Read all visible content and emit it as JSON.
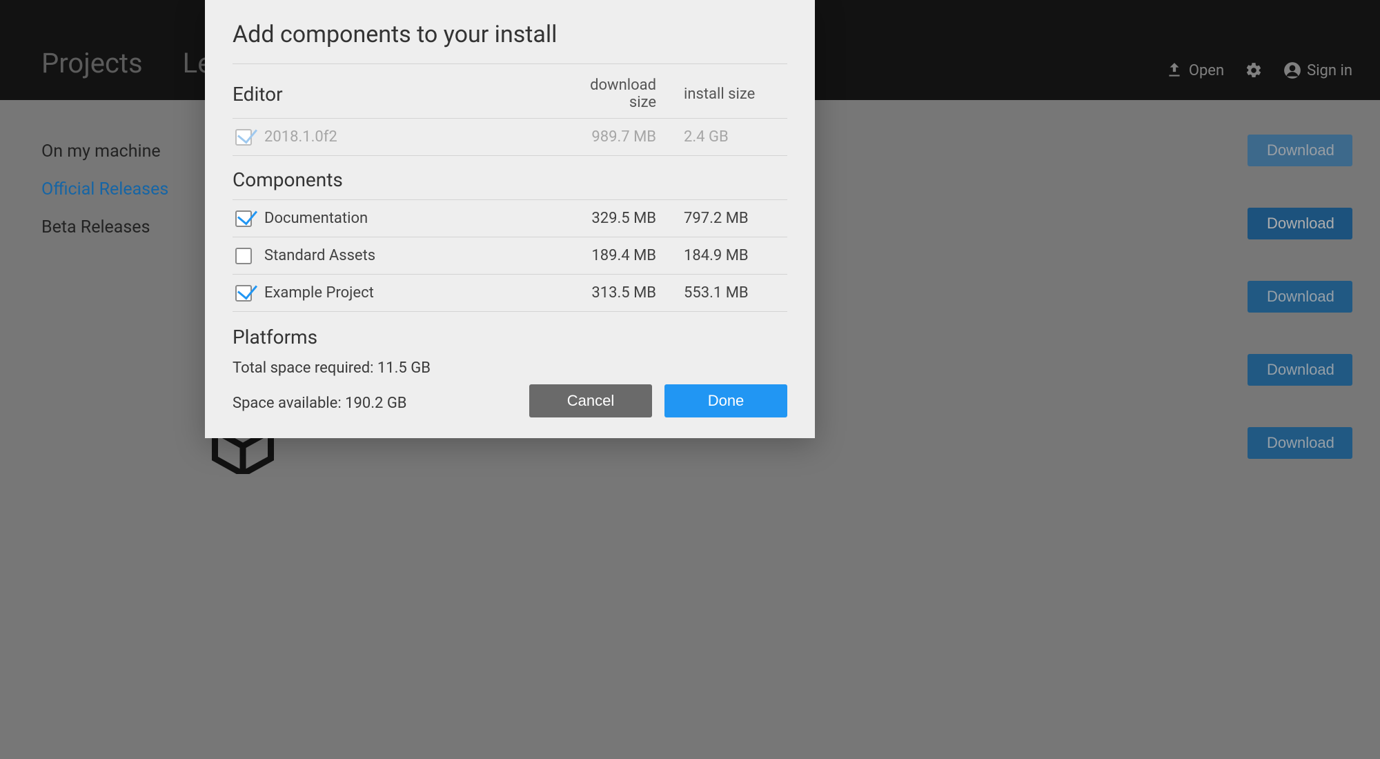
{
  "topbar": {
    "tabs": [
      "Projects",
      "Learn"
    ],
    "open_label": "Open",
    "signin_label": "Sign in"
  },
  "sidebar": {
    "items": [
      {
        "label": "On my machine",
        "active": false
      },
      {
        "label": "Official Releases",
        "active": true
      },
      {
        "label": "Beta Releases",
        "active": false
      }
    ]
  },
  "downloads": {
    "button_label": "Download"
  },
  "modal": {
    "title": "Add components to your install",
    "columns": {
      "download": "download size",
      "install": "install size"
    },
    "sections": {
      "editor": {
        "heading": "Editor",
        "rows": [
          {
            "name": "2018.1.0f2",
            "download_size": "989.7 MB",
            "install_size": "2.4 GB",
            "checked": true,
            "disabled": true
          }
        ]
      },
      "components": {
        "heading": "Components",
        "rows": [
          {
            "name": "Documentation",
            "download_size": "329.5 MB",
            "install_size": "797.2 MB",
            "checked": true,
            "disabled": false
          },
          {
            "name": "Standard Assets",
            "download_size": "189.4 MB",
            "install_size": "184.9 MB",
            "checked": false,
            "disabled": false
          },
          {
            "name": "Example Project",
            "download_size": "313.5 MB",
            "install_size": "553.1 MB",
            "checked": true,
            "disabled": false
          }
        ]
      },
      "platforms": {
        "heading": "Platforms"
      }
    },
    "total_required_label": "Total space required: ",
    "total_required_value": "11.5 GB",
    "space_available_label": "Space available: ",
    "space_available_value": "190.2 GB",
    "cancel_label": "Cancel",
    "done_label": "Done"
  }
}
